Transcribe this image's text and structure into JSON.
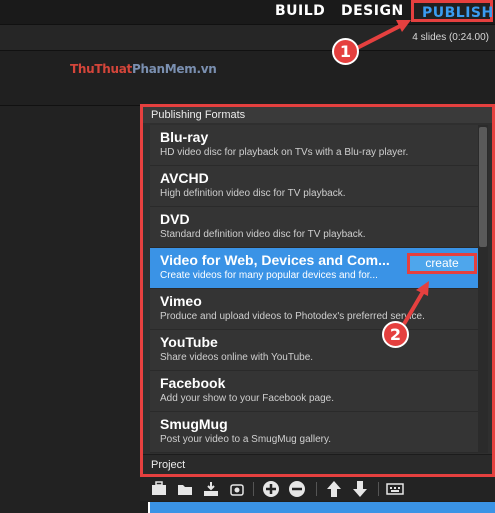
{
  "topbar": {
    "tabs": [
      "BUILD",
      "DESIGN",
      "PUBLISH"
    ]
  },
  "subbar": {
    "slides_info": "4 slides (0:24.00)"
  },
  "watermark": {
    "part_a": "ThuThuat",
    "part_b": "PhanMem",
    "part_c": ".vn"
  },
  "panel": {
    "title": "Publishing Formats",
    "items": [
      {
        "title": "Blu-ray",
        "desc": "HD video disc for playback on TVs with a Blu-ray player."
      },
      {
        "title": "AVCHD",
        "desc": "High definition video disc for TV playback."
      },
      {
        "title": "DVD",
        "desc": "Standard definition video disc for TV playback."
      },
      {
        "title": "Video for Web, Devices and Com...",
        "desc": "Create videos for many popular devices and for..."
      },
      {
        "title": "Vimeo",
        "desc": "Produce and upload videos to Photodex's preferred service."
      },
      {
        "title": "YouTube",
        "desc": "Share videos online with YouTube."
      },
      {
        "title": "Facebook",
        "desc": "Add your show to your Facebook page."
      },
      {
        "title": "SmugMug",
        "desc": "Post your video to a SmugMug gallery."
      }
    ],
    "create_label": "create",
    "project_label": "Project"
  },
  "toolbar": {
    "icons": [
      "briefcase-icon",
      "open-folder-icon",
      "save-icon",
      "camera-icon",
      "add-icon",
      "remove-icon",
      "move-up-icon",
      "move-down-icon",
      "keyboard-icon"
    ]
  },
  "callouts": [
    "1",
    "2"
  ],
  "colors": {
    "accent_blue": "#3a93e6",
    "callout_red": "#e5403f"
  }
}
